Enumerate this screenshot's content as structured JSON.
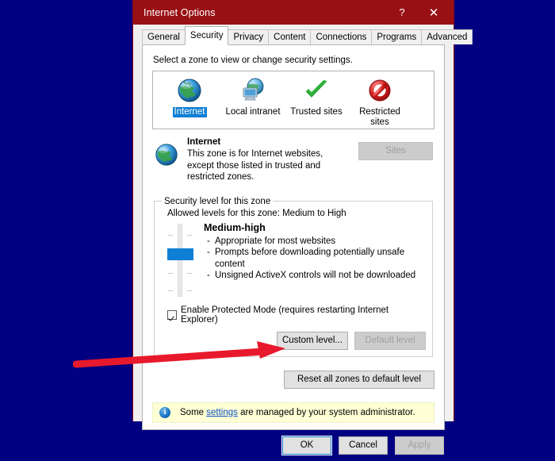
{
  "window": {
    "title": "Internet Options",
    "help_icon": "question-mark-icon",
    "help_label": "?",
    "close_label": "✕",
    "titlebar_color": "#991014"
  },
  "tabs": [
    {
      "label": "General",
      "active": false
    },
    {
      "label": "Security",
      "active": true
    },
    {
      "label": "Privacy",
      "active": false
    },
    {
      "label": "Content",
      "active": false
    },
    {
      "label": "Connections",
      "active": false
    },
    {
      "label": "Programs",
      "active": false
    },
    {
      "label": "Advanced",
      "active": false
    }
  ],
  "security_tab": {
    "intro": "Select a zone to view or change security settings.",
    "zones": [
      {
        "label": "Internet",
        "icon": "globe-icon",
        "selected": true
      },
      {
        "label": "Local intranet",
        "icon": "intranet-computer-icon",
        "selected": false
      },
      {
        "label": "Trusted sites",
        "icon": "green-check-icon",
        "selected": false
      },
      {
        "label": "Restricted sites",
        "icon": "red-no-entry-icon",
        "selected": false
      }
    ],
    "selected_zone": {
      "icon": "globe-icon",
      "name": "Internet",
      "description": "This zone is for Internet websites, except those listed in trusted and restricted zones.",
      "sites_button": {
        "label": "Sites",
        "enabled": false
      }
    },
    "security_level": {
      "legend": "Security level for this zone",
      "allowed_levels": "Allowed levels for this zone: Medium to High",
      "level_name": "Medium-high",
      "bullets": [
        "Appropriate for most websites",
        "Prompts before downloading potentially unsafe content",
        "Unsigned ActiveX controls will not be downloaded"
      ],
      "slider": {
        "name": "security-level-slider",
        "thumb_color": "#0f7fd4",
        "position_percent": 62
      },
      "protected_mode": {
        "label": "Enable Protected Mode (requires restarting Internet Explorer)",
        "checked": true
      },
      "custom_level_button": {
        "label": "Custom level...",
        "enabled": true
      },
      "default_level_button": {
        "label": "Default level",
        "enabled": false
      }
    },
    "reset_button": {
      "label": "Reset all zones to default level",
      "enabled": true
    },
    "info_bar": {
      "icon": "info-circle-icon",
      "icon_glyph": "i",
      "text_before": "Some ",
      "link": "settings",
      "text_after": " are managed by your system administrator.",
      "background_color": "#ffffd5",
      "link_color": "#0b4fc4"
    }
  },
  "footer": {
    "ok": {
      "label": "OK",
      "enabled": true,
      "default": true
    },
    "cancel": {
      "label": "Cancel",
      "enabled": true
    },
    "apply": {
      "label": "Apply",
      "enabled": false
    }
  },
  "annotation": {
    "arrow": {
      "name": "red-annotation-arrow",
      "color": "#e8192c",
      "points_to": "reset-all-zones-button"
    }
  },
  "desktop": {
    "background_color": "#000080"
  }
}
